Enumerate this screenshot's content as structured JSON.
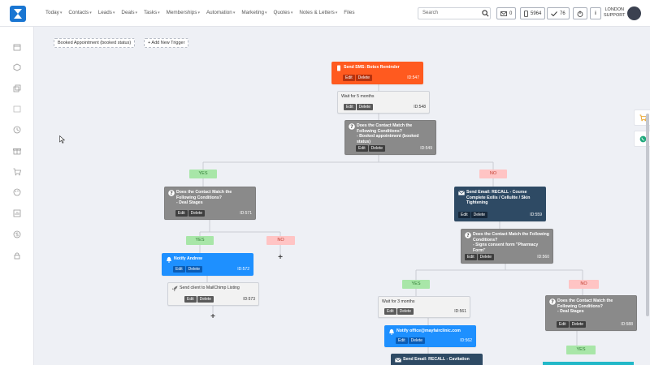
{
  "nav": [
    "Today",
    "Contacts",
    "Leads",
    "Deals",
    "Tasks",
    "Memberships",
    "Automation",
    "Marketing",
    "Quotes",
    "Notes & Letters",
    "Files"
  ],
  "search_placeholder": "Search",
  "badges": {
    "mail": "0",
    "phone": "5964",
    "check": "76"
  },
  "support": {
    "line1": "LONDON",
    "line2": "SUPPORT"
  },
  "triggers": {
    "booked": "Booked Appointment (booked status)",
    "add": "+ Add New Trigger"
  },
  "btn": {
    "edit": "Edit",
    "delete": "Delete"
  },
  "nodes": {
    "sms": {
      "title": "Send SMS: Botox Reminder",
      "id": "ID:547"
    },
    "wait1": {
      "title": "Wait for 5 months",
      "id": "ID:548"
    },
    "cond1": {
      "title": "Does the Contact Match the Following Conditions?",
      "sub": "- Booked appointment (booked status)",
      "id": "ID:549"
    },
    "cond2": {
      "title": "Does the Contact Match the Following Conditions?",
      "sub": "- Deal Stages",
      "id": "ID:571"
    },
    "email1": {
      "title": "Send Email: RECALL - Course Complete Exilis / Cellulite / Skin Tightening",
      "id": "ID:559"
    },
    "notify1": {
      "title": "Notify Andrew",
      "id": "ID:572"
    },
    "mailchimp": {
      "title": "Send client to MailChimp Listing",
      "id": "ID:573"
    },
    "cond3": {
      "title": "Does the Contact Match the Following Conditions?",
      "sub": "- Signs consent form \"Pharmacy Form\"",
      "id": "ID:560"
    },
    "wait2": {
      "title": "Wait for 3 months",
      "id": "ID:561"
    },
    "notify2": {
      "title": "Notify office@mayfairclinic.com",
      "id": "ID:562"
    },
    "email2": {
      "title": "Send Email: RECALL - Cavitation"
    },
    "cond4": {
      "title": "Does the Contact Match the Following Conditions?",
      "sub": "- Deal Stages",
      "id": "ID:588"
    }
  },
  "yes": "YES",
  "no": "NO",
  "plus": "+",
  "colors": {
    "sms": "#ff5a1f",
    "condition": "#8a8a8a",
    "notify": "#1e90ff",
    "email": "#2e4a64",
    "yes": "#a8e6a8",
    "no": "#ffc4c4"
  }
}
